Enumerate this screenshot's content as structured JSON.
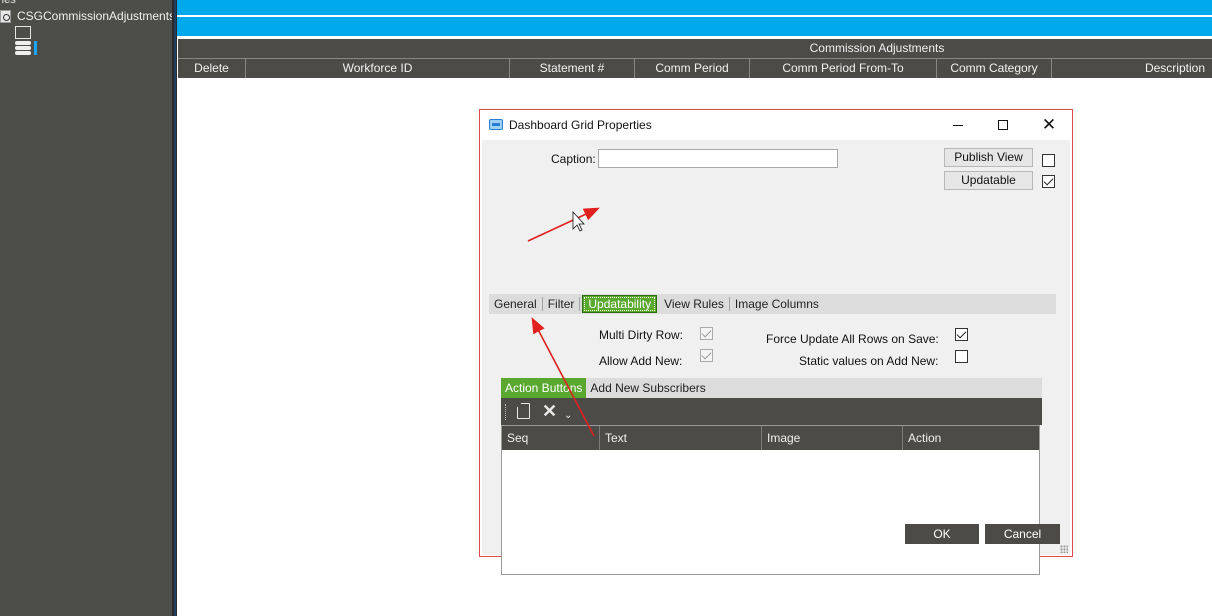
{
  "sidebar": {
    "top_text": "ries",
    "item_label": "CSGCommissionAdjustments"
  },
  "grid": {
    "title": "Commission Adjustments",
    "columns": [
      "Delete",
      "Workforce ID",
      "Statement #",
      "Comm Period",
      "Comm Period From-To",
      "Comm Category",
      "Description"
    ]
  },
  "dialog": {
    "title": "Dashboard Grid Properties",
    "caption_label": "Caption:",
    "caption_value": "",
    "publish_view_label": "Publish View",
    "publish_view_checked": false,
    "updatable_label": "Updatable",
    "updatable_checked": true,
    "tabs": [
      "General",
      "Filter",
      "Updatability",
      "View Rules",
      "Image Columns"
    ],
    "active_tab": "Updatability",
    "multi_dirty_row_label": "Multi Dirty Row:",
    "multi_dirty_row_checked": true,
    "allow_add_new_label": "Allow Add New:",
    "allow_add_new_checked": true,
    "force_update_label": "Force Update All Rows on Save:",
    "force_update_checked": true,
    "static_values_label": "Static values on Add New:",
    "static_values_checked": false,
    "inner_tabs": [
      "Action Buttons",
      "Add New Subscribers"
    ],
    "action_grid_columns": [
      "Seq",
      "Text",
      "Image",
      "Action"
    ],
    "ok_label": "OK",
    "cancel_label": "Cancel"
  },
  "colors": {
    "accent_blue": "#00a8ec",
    "header_dark": "#4d4b48",
    "active_tab_green": "#5aa830",
    "annotation_red": "#e0201f"
  },
  "icons": [
    "doc-search-icon",
    "grid-icon",
    "database-icon",
    "app-icon",
    "new-icon",
    "delete-icon",
    "dropdown-icon"
  ]
}
